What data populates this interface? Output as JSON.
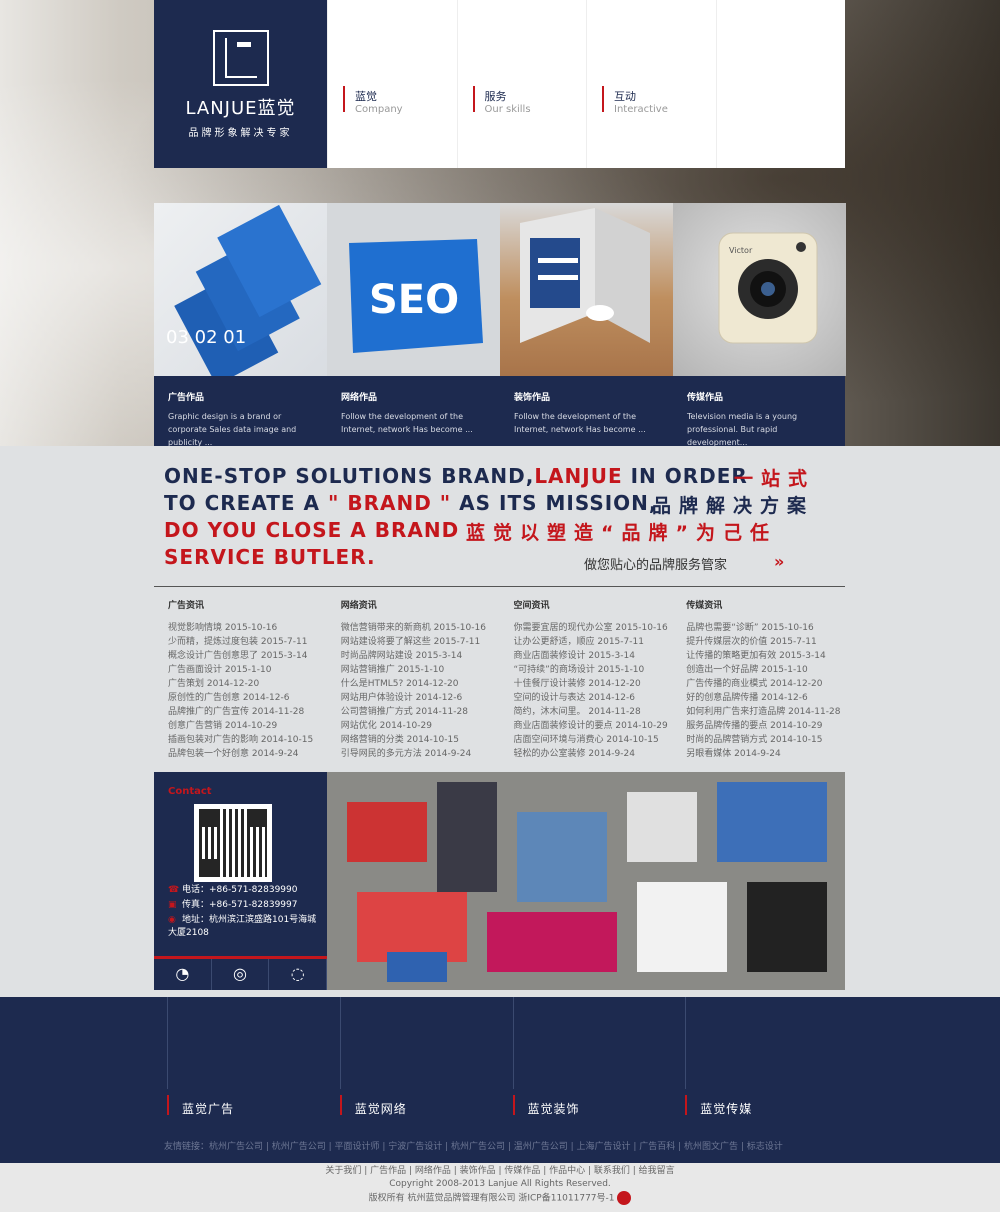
{
  "brand": {
    "name": "LANJUE蓝觉",
    "tagline": "品牌形象解决专家"
  },
  "nav": [
    {
      "cn": "蓝觉",
      "en": "Company"
    },
    {
      "cn": "服务",
      "en": "Our skills"
    },
    {
      "cn": "互动",
      "en": "Interactive"
    }
  ],
  "services": [
    {
      "title": "广告作品",
      "desc": "Graphic design is a brand or corporate Sales data image and publicity ...",
      "img_text": "03 02 01"
    },
    {
      "title": "网络作品",
      "desc": "Follow the development of the Internet, network Has become ...",
      "img_text": "SEO"
    },
    {
      "title": "装饰作品",
      "desc": "Follow the development of the Internet, network Has become ...",
      "img_text": ""
    },
    {
      "title": "传媒作品",
      "desc": "Television media is a young professional. But rapid development...",
      "img_text": "Victor"
    }
  ],
  "slogan": {
    "l1a": "ONE-STOP SOLUTIONS BRAND,",
    "l1b": "LANJUE",
    "l1c": " IN ORDER",
    "l2a": "TO CREATE A ",
    "l2b": "\" BRAND \"",
    "l2c": " AS ITS MISSION,",
    "l3": "DO YOU CLOSE A BRAND",
    "l4": "SERVICE BUTLER.",
    "cn1": "一站式",
    "cn2": "品牌解决方案",
    "cn3": "蓝觉以塑造“品牌”为己任",
    "butler": "做您贴心的品牌服务管家",
    "arrow": "»"
  },
  "news": [
    {
      "title": "广告资讯",
      "items": [
        "视觉影响情境 2015-10-16",
        "少而精，提炼过度包装 2015-7-11",
        "概念设计广告创意思了 2015-3-14",
        "广告画面设计 2015-1-10",
        "广告策划 2014-12-20",
        "原创性的广告创意 2014-12-6",
        "品牌推广的广告宣传 2014-11-28",
        "创意广告营销 2014-10-29",
        "插画包装对广告的影响 2014-10-15",
        "品牌包装一个好创意 2014-9-24"
      ]
    },
    {
      "title": "网络资讯",
      "items": [
        "微信营销带来的新商机 2015-10-16",
        "网站建设将要了解这些 2015-7-11",
        "时尚品牌网站建设 2015-3-14",
        "网站营销推广 2015-1-10",
        "什么是HTML5? 2014-12-20",
        "网站用户体验设计 2014-12-6",
        "公司营销推广方式 2014-11-28",
        "网站优化 2014-10-29",
        "网络营销的分类 2014-10-15",
        "引导网民的多元方法 2014-9-24"
      ]
    },
    {
      "title": "空间资讯",
      "items": [
        "你需要宜居的现代办公室 2015-10-16",
        "让办公更舒适，顺应 2015-7-11",
        "商业店面装修设计 2015-3-14",
        "“可持续”的商场设计 2015-1-10",
        "十佳餐厅设计装修 2014-12-20",
        "空间的设计与表达 2014-12-6",
        "简约，沐木间里。 2014-11-28",
        "商业店面装修设计的要点 2014-10-29",
        "店面空间环境与消费心 2014-10-15",
        "轻松的办公室装修 2014-9-24"
      ]
    },
    {
      "title": "传媒资讯",
      "items": [
        "品牌也需要“诊断” 2015-10-16",
        "提升传媒层次的价值 2015-7-11",
        "让传播的策略更加有效 2015-3-14",
        "创造出一个好品牌 2015-1-10",
        "广告传播的商业模式 2014-12-20",
        "好的创意品牌传播 2014-12-6",
        "如何利用广告来打造品牌 2014-11-28",
        "服务品牌传播的要点 2014-10-29",
        "时尚的品牌营销方式 2014-10-15",
        "另眼看媒体 2014-9-24"
      ]
    }
  ],
  "contact": {
    "title": "Contact",
    "phone": "电话：+86-571-82839990",
    "fax": "传真：+86-571-82839997",
    "address": "地址：杭州滨江滨盛路101号海城大厦2108"
  },
  "footer": {
    "cols": [
      "蓝觉广告",
      "蓝觉网络",
      "蓝觉装饰",
      "蓝觉传媒"
    ],
    "links": "友情链接：杭州广告公司 | 杭州广告公司 | 平面设计师 | 宁波广告设计 | 杭州广告公司 | 温州广告公司 | 上海广告设计 | 广告百科 | 杭州图文广告 | 标志设计",
    "nav": "关于我们 | 广告作品 | 网络作品 | 装饰作品 | 传媒作品 | 作品中心 | 联系我们 | 给我留言",
    "copyright": "Copyright 2008-2013 Lanjue All Rights Reserved.",
    "icp": "版权所有 杭州蓝觉品牌管理有限公司 浙ICP备11011777号-1"
  }
}
